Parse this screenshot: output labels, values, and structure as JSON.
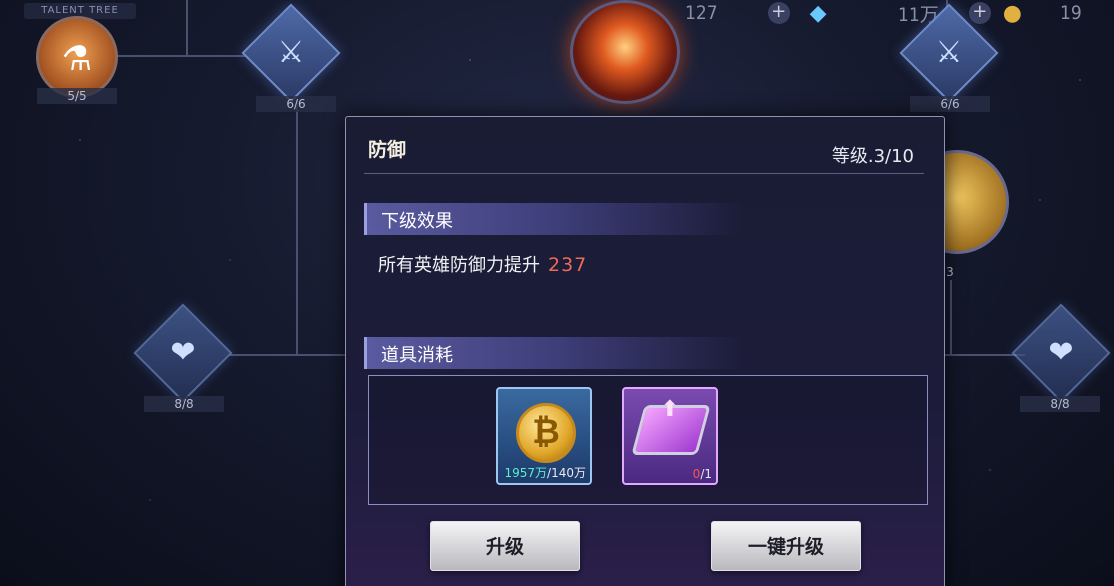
{
  "talent_tree": {
    "title": "TALENT TREE",
    "nodes": [
      {
        "name": "potion",
        "count": "5/5"
      },
      {
        "name": "attack-1",
        "count": "6/6"
      },
      {
        "name": "attack-2",
        "count": "6/6"
      },
      {
        "name": "shield-left",
        "count": "8/8"
      },
      {
        "name": "shield-right",
        "count": "8/8"
      },
      {
        "name": "gold-node",
        "count": "3"
      }
    ]
  },
  "resources": {
    "first_value": "127",
    "second_value": "11万",
    "third_value": "19"
  },
  "modal": {
    "title": "防御",
    "level": "等级.3/10",
    "next_effect_label": "下级效果",
    "effect_text": "所有英雄防御力提升",
    "effect_value": "237",
    "cost_label": "道具消耗",
    "items": [
      {
        "name": "gold-coin",
        "have": "1957万",
        "need": "/140万"
      },
      {
        "name": "purple-chip",
        "have": "0",
        "need": "/1"
      }
    ],
    "upgrade_button": "升级",
    "one_key_button": "一键升级"
  },
  "colors": {
    "accent": "#ef6a55",
    "have_enough": "#5cf0c8",
    "have_not_enough": "#ff5050"
  }
}
